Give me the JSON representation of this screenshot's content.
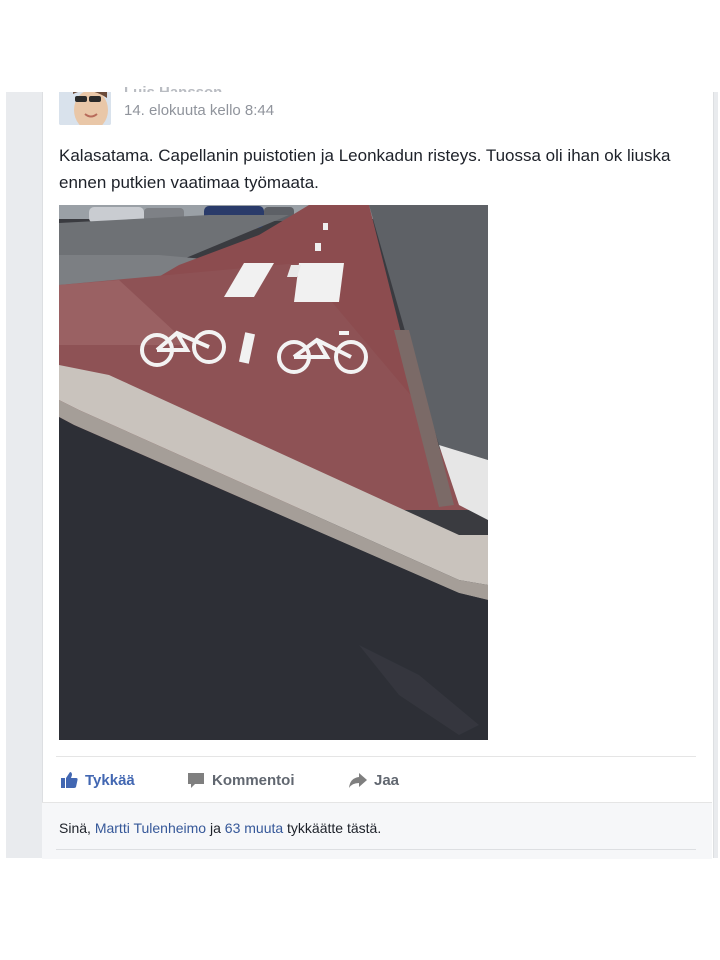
{
  "post": {
    "author": "Luis Hansson",
    "timestamp": "14. elokuuta kello 8:44",
    "text": "Kalasatama. Capellanin puistotien ja Leonkadun risteys. Tuossa oli ihan ok liuska ennen putkien vaatimaa työmaata."
  },
  "actions": {
    "like_label": "Tykkää",
    "comment_label": "Kommentoi",
    "share_label": "Jaa"
  },
  "likes": {
    "prefix": "Sinä, ",
    "friend": "Martti Tulenheimo",
    "middle": " ja ",
    "others": "63 muuta",
    "suffix": " tykkäätte tästä."
  },
  "colors": {
    "link": "#365899",
    "like_active": "#4267b2",
    "muted": "#90949c"
  },
  "icons": {
    "like": "thumbs-up-icon",
    "comment": "comment-icon",
    "share": "share-arrow-icon"
  }
}
